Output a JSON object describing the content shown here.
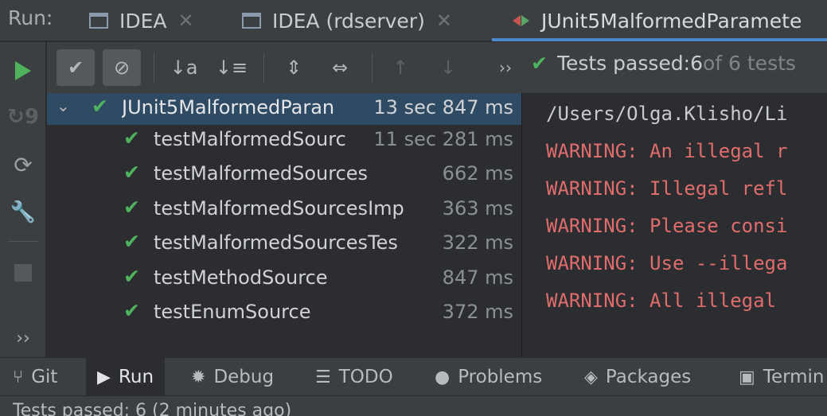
{
  "tabbar": {
    "run_label": "Run:",
    "tabs": [
      {
        "label": "IDEA",
        "closable": true
      },
      {
        "label": "IDEA (rdserver)",
        "closable": true
      },
      {
        "label": "JUnit5MalformedParamete",
        "closable": false,
        "active": true
      }
    ]
  },
  "toolbar": {
    "show_passed": "✔",
    "show_ignored": "⊘",
    "sort_alpha": "↓a",
    "sort_duration": "↓≡",
    "expand_all": "⇕",
    "collapse_all": "⇔",
    "prev_failed": "↑",
    "next_failed": "↓",
    "more": "››",
    "status": {
      "prefix": "Tests passed: ",
      "passed": "6",
      "of": " of 6 tests"
    }
  },
  "tree": {
    "root": {
      "name": "JUnit5MalformedParan",
      "duration": "13 sec 847 ms"
    },
    "children": [
      {
        "name": "testMalformedSourc",
        "duration": "11 sec 281 ms"
      },
      {
        "name": "testMalformedSources",
        "duration": "662 ms"
      },
      {
        "name": "testMalformedSourcesImp",
        "duration": "363 ms"
      },
      {
        "name": "testMalformedSourcesTes",
        "duration": "322 ms"
      },
      {
        "name": "testMethodSource",
        "duration": "847 ms"
      },
      {
        "name": "testEnumSource",
        "duration": "372 ms"
      }
    ]
  },
  "console": {
    "lines": [
      {
        "text": "/Users/Olga.Klisho/Li",
        "kind": "path"
      },
      {
        "text": "WARNING: An illegal r",
        "kind": "warn"
      },
      {
        "text": "WARNING: Illegal refl",
        "kind": "warn"
      },
      {
        "text": "WARNING: Please consi",
        "kind": "warn"
      },
      {
        "text": "WARNING: Use --illega",
        "kind": "warn"
      },
      {
        "text": "WARNING: All illegal",
        "kind": "warn"
      }
    ]
  },
  "bottombar": {
    "items": [
      {
        "label": "Git",
        "icon": "git-branch-icon"
      },
      {
        "label": "Run",
        "icon": "run-icon",
        "active": true
      },
      {
        "label": "Debug",
        "icon": "bug-icon"
      },
      {
        "label": "TODO",
        "icon": "list-icon"
      },
      {
        "label": "Problems",
        "icon": "alert-icon"
      },
      {
        "label": "Packages",
        "icon": "layers-icon"
      },
      {
        "label": "Termin",
        "icon": "terminal-icon"
      }
    ]
  },
  "statusbar": {
    "text": "Tests passed: 6 (2 minutes ago)"
  },
  "colors": {
    "accent": "#4a88c7",
    "pass": "#4fb35d",
    "warning_text": "#e06c6c",
    "selection": "#2f4b63"
  }
}
